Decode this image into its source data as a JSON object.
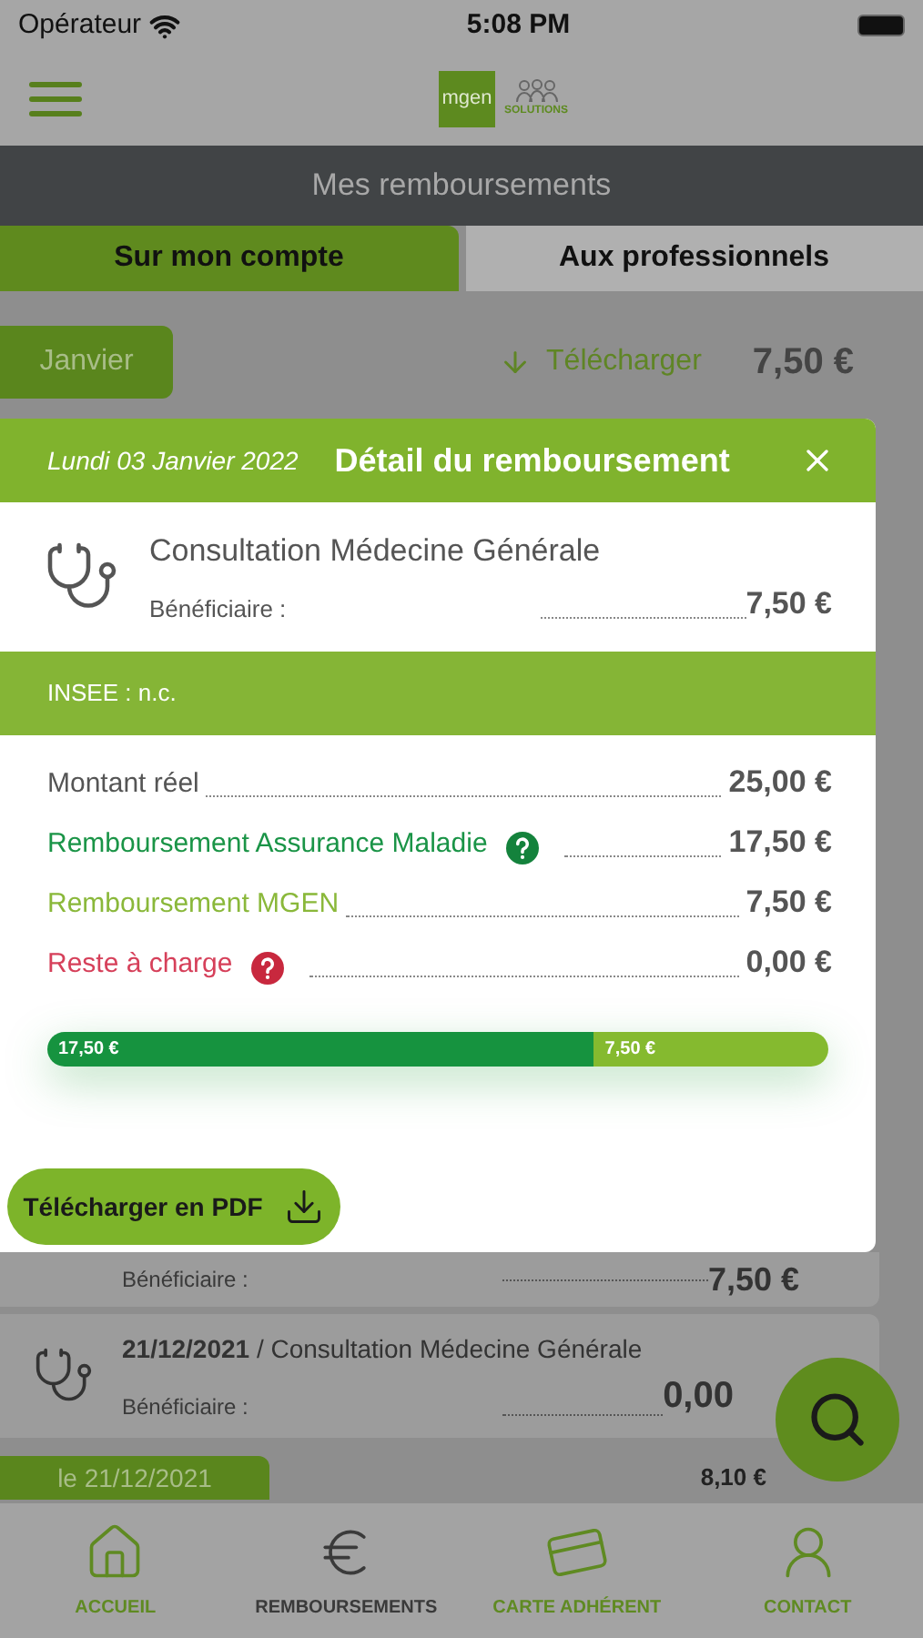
{
  "status_bar": {
    "carrier": "Opérateur",
    "time": "5:08 PM"
  },
  "header": {
    "logo_text": "mgen",
    "logo_subtitle": "SOLUTIONS"
  },
  "page_title": "Mes remboursements",
  "tabs": [
    {
      "label": "Sur mon compte",
      "selected": true
    },
    {
      "label": "Aux professionnels",
      "selected": false
    }
  ],
  "month": {
    "label": "Janvier",
    "download": "Télécharger",
    "total": "7,50 €"
  },
  "modal": {
    "date": "Lundi 03 Janvier 2022",
    "title": "Détail du remboursement",
    "act": "Consultation Médecine Générale",
    "beneficiary": "Bénéficiaire :",
    "amount": "7,50 €",
    "insee": "INSEE : n.c.",
    "lines": [
      {
        "label": "Montant réel",
        "value": "25,00 €",
        "kind": "real",
        "help": false
      },
      {
        "label": "Remboursement Assurance Maladie",
        "value": "17,50 €",
        "kind": "insurance",
        "help": true
      },
      {
        "label": "Remboursement MGEN",
        "value": "7,50 €",
        "kind": "mgen",
        "help": false
      },
      {
        "label": "Reste à charge",
        "value": "0,00 €",
        "kind": "remainder",
        "help": true
      }
    ],
    "bar": [
      {
        "label": "17,50 €",
        "level": 0.7,
        "kind": "insurance"
      },
      {
        "label": "7,50 €",
        "level": 0.3,
        "kind": "mgen"
      }
    ],
    "pdf_button": "Télécharger en PDF"
  },
  "entries": [
    {
      "beneficiary": "Bénéficiaire :",
      "amount": "7,50 €"
    },
    {
      "title": "**21/12/2021** / Consultation Médecine Générale",
      "beneficiary": "Bénéficiaire :",
      "amount": "0,00"
    }
  ],
  "next_group": {
    "label": "le 21/12/2021",
    "total": "8,10 €"
  },
  "nav": [
    {
      "label": "ACCUEIL",
      "selected": false,
      "kind": "home"
    },
    {
      "label": "REMBOURSEMENTS",
      "selected": true,
      "kind": "euro"
    },
    {
      "label": "CARTE ADHÉRENT",
      "selected": false,
      "kind": "card"
    },
    {
      "label": "CONTACT",
      "selected": false,
      "kind": "contact"
    }
  ]
}
